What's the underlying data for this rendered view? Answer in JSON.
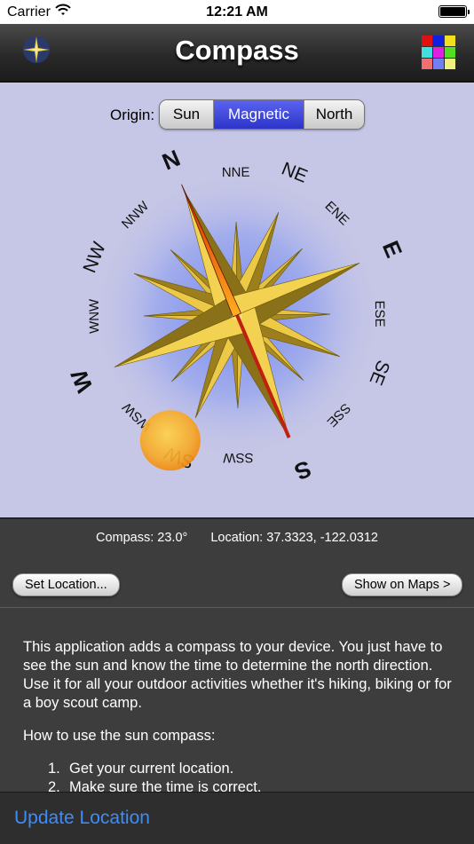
{
  "status": {
    "carrier": "Carrier",
    "time": "12:21 AM"
  },
  "nav": {
    "title": "Compass",
    "left_icon": "compass-rose-icon",
    "right_icon": "color-grid-icon"
  },
  "origin": {
    "label": "Origin:",
    "options": [
      "Sun",
      "Magnetic",
      "North"
    ],
    "selected": "Magnetic"
  },
  "compass": {
    "rotation_deg": -23,
    "needle_heading_deg": -23,
    "sun_heading_deg": 208,
    "labels": [
      "N",
      "NNE",
      "NE",
      "ENE",
      "E",
      "ESE",
      "SE",
      "SSE",
      "S",
      "SSW",
      "SW",
      "WSW",
      "W",
      "WNW",
      "NW",
      "NNW"
    ]
  },
  "info": {
    "compass": "Compass: 23.0°",
    "location": "Location:  37.3323,  -122.0312"
  },
  "buttons": {
    "set_location": "Set Location...",
    "show_on_maps": "Show on Maps >"
  },
  "description": "This application adds a compass to your device. You just have to see the sun and know the time to determine the north direction. Use it for all your outdoor activities whether it's hiking, biking or for a boy scout camp.",
  "howto": {
    "title": "How to use the sun compass:",
    "steps": [
      "Get your current location.",
      "Make sure the time is correct."
    ]
  },
  "toolbar": {
    "update": "Update Location"
  },
  "colors": {
    "accent": "#3f8cf8",
    "selected_segment": "#3a42dc",
    "panel": "#c6c6e6",
    "background": "#3d3d3d"
  }
}
